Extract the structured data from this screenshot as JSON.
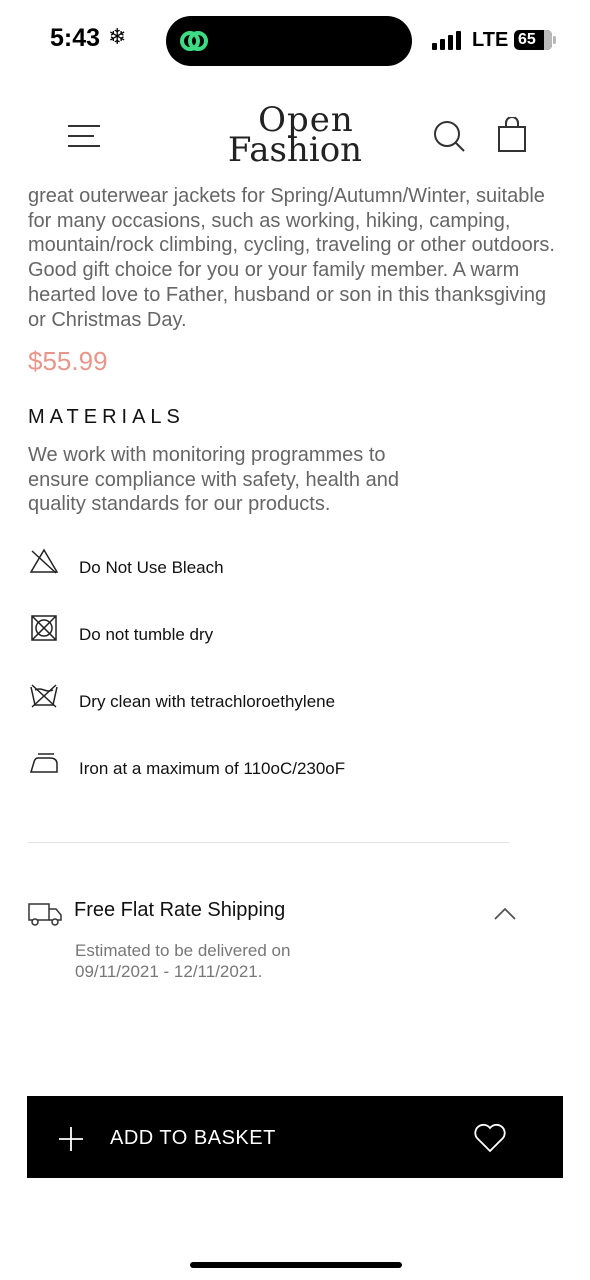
{
  "status_bar": {
    "time": "5:43",
    "network": "LTE",
    "battery": "65"
  },
  "header": {
    "logo_line1": "Open",
    "logo_line2": "Fashion"
  },
  "product": {
    "description": "great outerwear jackets for Spring/Autumn/Winter, suitable for many occasions, such as working, hiking, camping, mountain/rock climbing, cycling, traveling or other outdoors. Good gift choice for you or your family member. A warm hearted love to Father, husband or son in this thanksgiving or Christmas Day.",
    "price": "$55.99",
    "price_color": "#e8968a"
  },
  "materials": {
    "title": "MATERIALS",
    "text": "We work with monitoring programmes to ensure compliance with safety, health and quality standards for our products.",
    "care": [
      {
        "icon": "no-bleach-icon",
        "label": "Do Not Use Bleach"
      },
      {
        "icon": "no-tumble-dry-icon",
        "label": "Do not tumble dry"
      },
      {
        "icon": "dry-clean-icon",
        "label": "Dry clean with tetrachloroethylene"
      },
      {
        "icon": "iron-icon",
        "label": "Iron at a maximum of 110oC/230oF"
      }
    ]
  },
  "shipping": {
    "title": "Free Flat Rate Shipping",
    "detail": "Estimated to be delivered on 09/11/2021 - 12/11/2021."
  },
  "actions": {
    "add_to_basket": "ADD TO BASKET"
  }
}
